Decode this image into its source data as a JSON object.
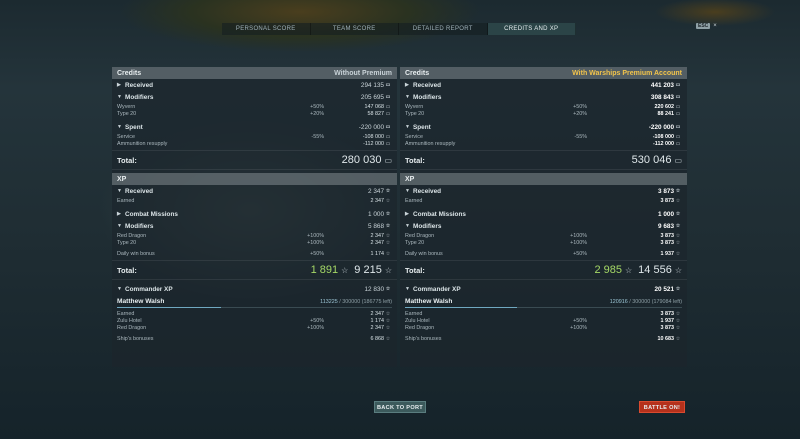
{
  "tabs": [
    {
      "label": "PERSONAL SCORE"
    },
    {
      "label": "TEAM SCORE"
    },
    {
      "label": "DETAILED REPORT"
    },
    {
      "label": "CREDITS AND XP"
    }
  ],
  "esc": {
    "key": "ESC",
    "icon": "×"
  },
  "left": {
    "credits_title": "Credits",
    "credits_sub": "Without Premium",
    "received": {
      "label": "Received",
      "value": "294 135"
    },
    "modifiers": {
      "label": "Modifiers",
      "value": "205 695"
    },
    "mod_rows": [
      {
        "label": "Wyvern",
        "pct": "+50%",
        "value": "147 068"
      },
      {
        "label": "Type 20",
        "pct": "+20%",
        "value": "58 827"
      }
    ],
    "spent": {
      "label": "Spent",
      "value": "-220 000"
    },
    "spent_rows": [
      {
        "label": "Service",
        "pct": "-55%",
        "value": "-108 000"
      },
      {
        "label": "Ammunition resupply",
        "pct": "",
        "value": "-112 000"
      }
    ],
    "credits_total": {
      "label": "Total:",
      "value": "280 030"
    },
    "xp_title": "XP",
    "xp_received": {
      "label": "Received",
      "value": "2 347"
    },
    "earned": {
      "label": "Earned",
      "value": "2 347"
    },
    "combat_missions": {
      "label": "Combat Missions",
      "value": "1 000"
    },
    "xp_modifiers": {
      "label": "Modifiers",
      "value": "5 868"
    },
    "xp_mod_rows": [
      {
        "label": "Red Dragon",
        "pct": "+100%",
        "value": "2 347"
      },
      {
        "label": "Type 20",
        "pct": "+100%",
        "value": "2 347"
      }
    ],
    "daily": {
      "label": "Daily win bonus",
      "pct": "+50%",
      "value": "1 174"
    },
    "xp_total": {
      "label": "Total:",
      "free": "1 891",
      "value": "9 215"
    },
    "commander": {
      "label": "Commander XP",
      "value": "12 830"
    },
    "cmdr_name": "Matthew Walsh",
    "cmdr_cur": "113225",
    "cmdr_rest": "/ 300000 (186775 left)",
    "cmdr_progress": 0.377,
    "cmdr_rows": [
      {
        "label": "Earned",
        "pct": "",
        "value": "2 347"
      },
      {
        "label": "Zulu Hotel",
        "pct": "+50%",
        "value": "1 174"
      },
      {
        "label": "Red Dragon",
        "pct": "+100%",
        "value": "2 347"
      }
    ],
    "ship_bonuses": {
      "label": "Ship's bonuses",
      "value": "6 868"
    }
  },
  "right": {
    "credits_title": "Credits",
    "credits_sub": "With Warships Premium Account",
    "received": {
      "label": "Received",
      "value": "441 203"
    },
    "modifiers": {
      "label": "Modifiers",
      "value": "308 843"
    },
    "mod_rows": [
      {
        "label": "Wyvern",
        "pct": "+50%",
        "value": "220 602"
      },
      {
        "label": "Type 20",
        "pct": "+20%",
        "value": "88 241"
      }
    ],
    "spent": {
      "label": "Spent",
      "value": "-220 000"
    },
    "spent_rows": [
      {
        "label": "Service",
        "pct": "-55%",
        "value": "-108 000"
      },
      {
        "label": "Ammunition resupply",
        "pct": "",
        "value": "-112 000"
      }
    ],
    "credits_total": {
      "label": "Total:",
      "value": "530 046"
    },
    "xp_title": "XP",
    "xp_received": {
      "label": "Received",
      "value": "3 873"
    },
    "earned": {
      "label": "Earned",
      "value": "3 873"
    },
    "combat_missions": {
      "label": "Combat Missions",
      "value": "1 000"
    },
    "xp_modifiers": {
      "label": "Modifiers",
      "value": "9 683"
    },
    "xp_mod_rows": [
      {
        "label": "Red Dragon",
        "pct": "+100%",
        "value": "3 873"
      },
      {
        "label": "Type 20",
        "pct": "+100%",
        "value": "3 873"
      }
    ],
    "daily": {
      "label": "Daily win bonus",
      "pct": "+50%",
      "value": "1 937"
    },
    "xp_total": {
      "label": "Total:",
      "free": "2 985",
      "value": "14 556"
    },
    "commander": {
      "label": "Commander XP",
      "value": "20 521"
    },
    "cmdr_name": "Matthew Walsh",
    "cmdr_cur": "120916",
    "cmdr_rest": "/ 300000 (179084 left)",
    "cmdr_progress": 0.403,
    "cmdr_rows": [
      {
        "label": "Earned",
        "pct": "",
        "value": "3 873"
      },
      {
        "label": "Zulu Hotel",
        "pct": "+50%",
        "value": "1 937"
      },
      {
        "label": "Red Dragon",
        "pct": "+100%",
        "value": "3 873"
      }
    ],
    "ship_bonuses": {
      "label": "Ship's bonuses",
      "value": "10 683"
    }
  },
  "buttons": {
    "back": "BACK TO PORT",
    "battle": "BATTLE ON!"
  }
}
